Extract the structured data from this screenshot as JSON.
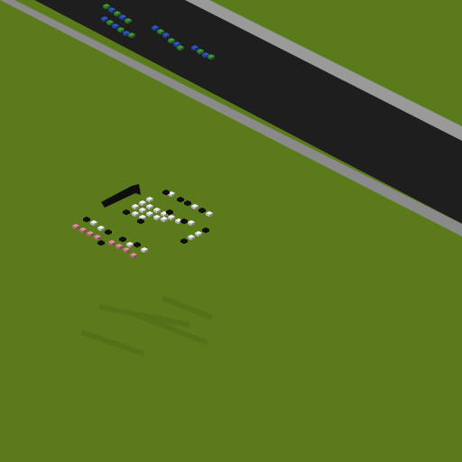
{
  "scene": {
    "description_key": "isometric-voxel-field",
    "colors": {
      "grass": "#5b7a1c",
      "grass_edge": "#53711a",
      "road": "#1e1e1e",
      "road_dark": "#141414",
      "road_edge": "#8a8a8a",
      "road_edge_light": "#b4b4b4",
      "blue_voxel": "#2f56c8",
      "green_voxel": "#3a9a3a",
      "white_voxel": "#f2f2f2",
      "black_voxel": "#0e0e0e",
      "pink_voxel": "#e58aa0",
      "shadow": "#4f6a18"
    }
  }
}
